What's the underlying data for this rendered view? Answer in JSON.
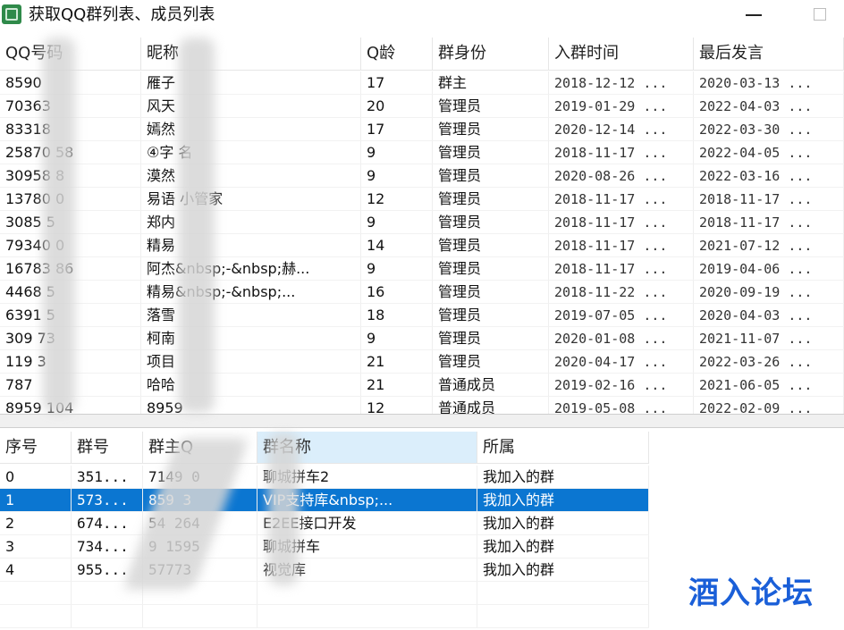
{
  "window": {
    "title": "获取QQ群列表、成员列表",
    "icon": "app-icon",
    "controls": [
      "minimize-icon",
      "maximize-icon"
    ]
  },
  "members_table": {
    "columns": [
      "QQ号码",
      "昵称",
      "Q龄",
      "群身份",
      "入群时间",
      "最后发言"
    ],
    "rows": [
      [
        "8590",
        "雁子",
        "17",
        "群主",
        "2018-12-12 ...",
        "2020-03-13 ..."
      ],
      [
        "70363",
        "风天",
        "20",
        "管理员",
        "2019-01-29 ...",
        "2022-04-03 ..."
      ],
      [
        "83318",
        "嫣然",
        "17",
        "管理员",
        "2020-12-14 ...",
        "2022-03-30 ..."
      ],
      [
        "25870   58",
        "④字   名",
        "9",
        "管理员",
        "2018-11-17 ...",
        "2022-04-05 ..."
      ],
      [
        "30958   8",
        "漠然",
        "9",
        "管理员",
        "2020-08-26 ...",
        "2022-03-16 ..."
      ],
      [
        "13780   0",
        "易语   小管家",
        "12",
        "管理员",
        "2018-11-17 ...",
        "2018-11-17 ..."
      ],
      [
        "3085   5",
        "郑内",
        "9",
        "管理员",
        "2018-11-17 ...",
        "2018-11-17 ..."
      ],
      [
        "79340   0",
        "精易",
        "14",
        "管理员",
        "2018-11-17 ...",
        "2021-07-12 ..."
      ],
      [
        "16783   86",
        "阿杰&nbsp;-&nbsp;赫...",
        "9",
        "管理员",
        "2018-11-17 ...",
        "2019-04-06 ..."
      ],
      [
        "4468   5",
        "精易&nbsp;-&nbsp;...",
        "16",
        "管理员",
        "2018-11-22 ...",
        "2020-09-19 ..."
      ],
      [
        "6391   5",
        "落雪",
        "18",
        "管理员",
        "2019-07-05 ...",
        "2020-04-03 ..."
      ],
      [
        "309   73",
        "柯南",
        "9",
        "管理员",
        "2020-01-08 ...",
        "2021-11-07 ..."
      ],
      [
        "119   3",
        "项目",
        "21",
        "管理员",
        "2020-04-17 ...",
        "2022-03-26 ..."
      ],
      [
        "787",
        "哈哈",
        "21",
        "普通成员",
        "2019-02-16 ...",
        "2021-06-05 ..."
      ],
      [
        "8959   104",
        "8959",
        "12",
        "普通成员",
        "2019-05-08 ...",
        "2022-02-09 ..."
      ]
    ]
  },
  "groups_table": {
    "columns": [
      "序号",
      "群号",
      "群主Q",
      "群名称",
      "所属"
    ],
    "sorted_column_index": 3,
    "selected_row_index": 1,
    "rows": [
      [
        "0",
        "351...",
        "7149   0",
        "聊城拼车2",
        "我加入的群"
      ],
      [
        "1",
        "573...",
        "859   3",
        "VIP支持库&nbsp;...",
        "我加入的群"
      ],
      [
        "2",
        "674...",
        "54   264",
        "E2EE接口开发",
        "我加入的群"
      ],
      [
        "3",
        "734...",
        "9   1595",
        "聊城拼车",
        "我加入的群"
      ],
      [
        "4",
        "955...",
        "   57773",
        "视觉库",
        "我加入的群"
      ]
    ]
  },
  "watermark": "酒入论坛",
  "colors": {
    "selection": "#0b76d1",
    "sorted_header": "#dbeefb",
    "watermark": "#1a5fd8"
  }
}
